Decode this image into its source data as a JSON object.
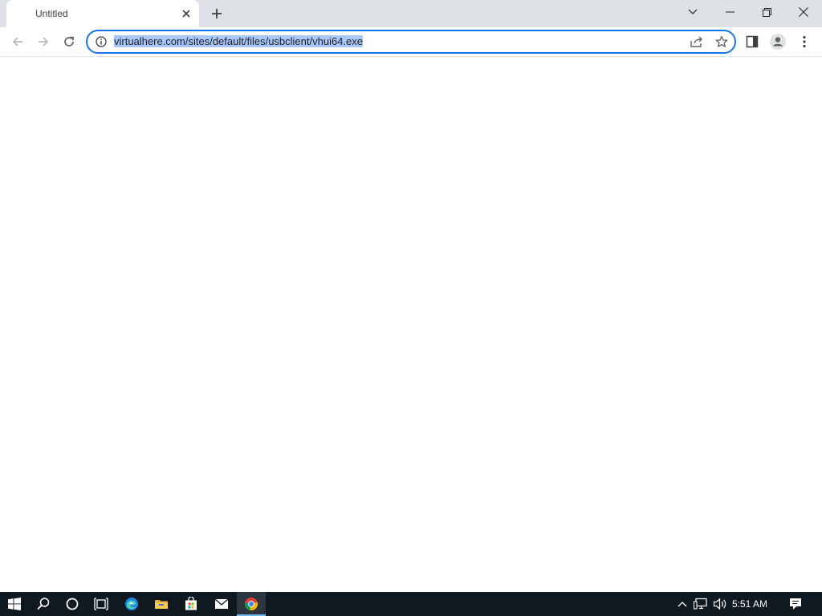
{
  "browser": {
    "tab": {
      "title": "Untitled"
    },
    "address_bar": {
      "url": "virtualhere.com/sites/default/files/usbclient/vhui64.exe",
      "selected": true
    }
  },
  "taskbar": {
    "apps": [
      {
        "name": "start",
        "icon": "windows-logo-icon"
      },
      {
        "name": "search",
        "icon": "search-icon"
      },
      {
        "name": "cortana",
        "icon": "cortana-circle-icon"
      },
      {
        "name": "task-view",
        "icon": "task-view-icon"
      },
      {
        "name": "edge",
        "icon": "edge-icon"
      },
      {
        "name": "file-explorer",
        "icon": "folder-icon"
      },
      {
        "name": "store",
        "icon": "store-bag-icon"
      },
      {
        "name": "mail",
        "icon": "mail-icon"
      },
      {
        "name": "chrome",
        "icon": "chrome-icon",
        "active": true
      }
    ],
    "clock": "5:51 AM"
  },
  "colors": {
    "tabstrip_bg": "#dee1e6",
    "omnibox_focus": "#1a73e8",
    "selection": "#a8c7fa",
    "taskbar_bg": "#101820",
    "taskbar_active_indicator": "#76b9ed"
  }
}
